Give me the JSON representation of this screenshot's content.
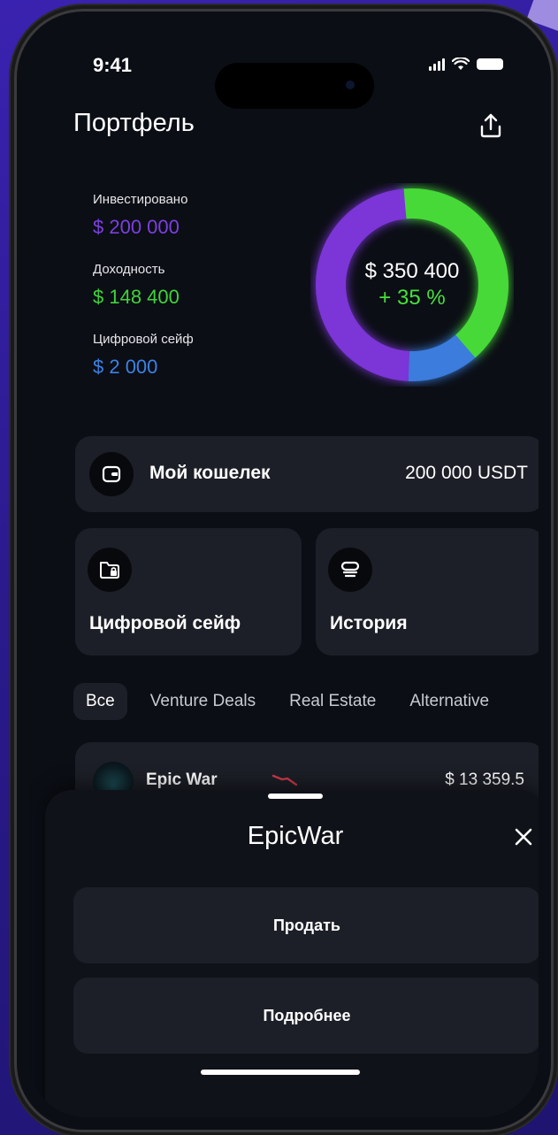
{
  "status": {
    "time": "9:41"
  },
  "header": {
    "title": "Портфель"
  },
  "stats": [
    {
      "label": "Инвестировано",
      "value": "$ 200 000",
      "color": "#7d3fe0"
    },
    {
      "label": "Доходность",
      "value": "$ 148 400",
      "color": "#3fd43a"
    },
    {
      "label": "Цифровой сейф",
      "value": "$ 2 000",
      "color": "#3b82e6"
    }
  ],
  "donut": {
    "total": "$ 350 400",
    "change": "+ 35 %",
    "segments": [
      {
        "name": "Доходность",
        "fraction": 0.4,
        "color": "#46d937"
      },
      {
        "name": "Цифровой сейф",
        "fraction": 0.12,
        "color": "#3b7bdc"
      },
      {
        "name": "Инвестировано",
        "fraction": 0.48,
        "color": "#7b35d6"
      }
    ]
  },
  "wallet": {
    "label": "Мой кошелек",
    "amount": "200 000 USDT"
  },
  "tiles": {
    "safe": "Цифровой сейф",
    "history": "История"
  },
  "filters": [
    "Все",
    "Venture Deals",
    "Real Estate",
    "Alternative"
  ],
  "asset": {
    "name": "Epic War",
    "value": "$ 13 359.5",
    "trend_color": "#d23a4a"
  },
  "sheet": {
    "title": "EpicWar",
    "sell": "Продать",
    "details": "Подробнее"
  }
}
